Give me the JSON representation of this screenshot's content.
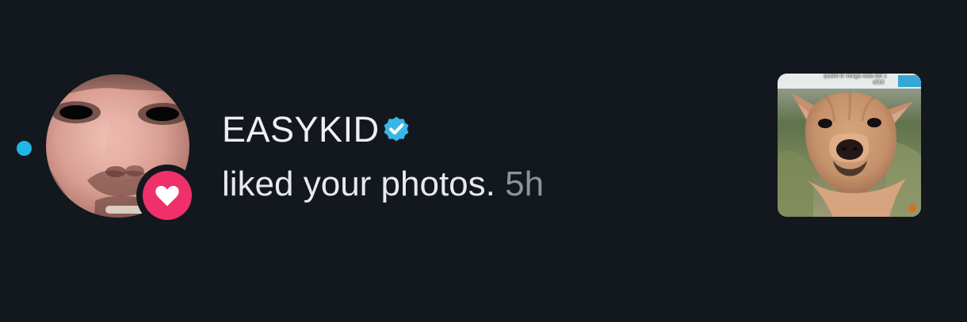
{
  "notification": {
    "user": {
      "username": "EASYKID",
      "verified": true,
      "avatar_description_icon": "profile-photo"
    },
    "activity": "liked your photos.",
    "time_ago": "5h",
    "unread": true,
    "reaction_icon": "heart-icon",
    "thumbnail": {
      "caption": "quello fc venga nata del 1\n                              sil10"
    }
  },
  "colors": {
    "background": "#12181d",
    "accent": "#1fb6e8",
    "heart": "#f0306a",
    "verified": "#38b6e8",
    "primary_text": "#eef0f3",
    "secondary_text": "#8b949b"
  }
}
